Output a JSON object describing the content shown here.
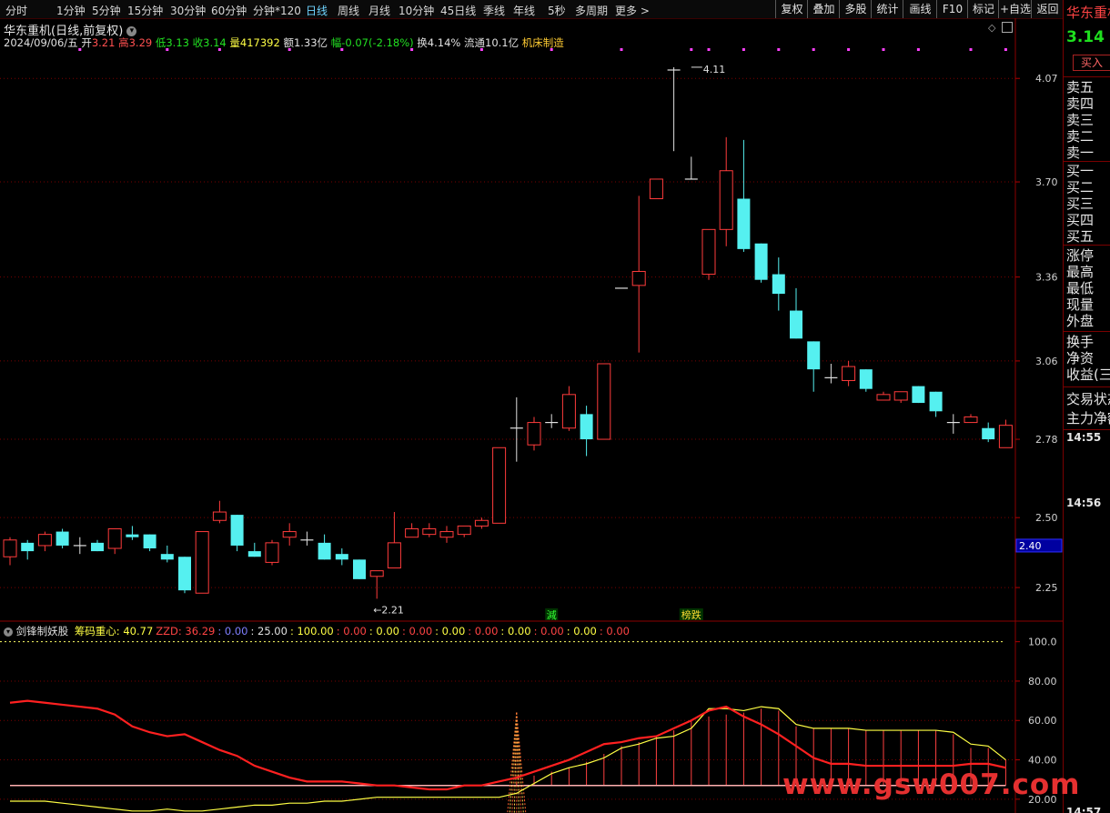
{
  "toolbar": {
    "periods": [
      {
        "label": "分时",
        "active": false
      },
      {
        "label": "1分钟",
        "active": false
      },
      {
        "label": "5分钟",
        "active": false
      },
      {
        "label": "15分钟",
        "active": false
      },
      {
        "label": "30分钟",
        "active": false
      },
      {
        "label": "60分钟",
        "active": false
      },
      {
        "label": "分钟*120",
        "active": false
      },
      {
        "label": "日线",
        "active": true
      },
      {
        "label": "周线",
        "active": false
      },
      {
        "label": "月线",
        "active": false
      },
      {
        "label": "10分钟",
        "active": false
      },
      {
        "label": "45日线",
        "active": false
      },
      {
        "label": "季线",
        "active": false
      },
      {
        "label": "年线",
        "active": false
      },
      {
        "label": "5秒",
        "active": false
      },
      {
        "label": "多周期",
        "active": false
      },
      {
        "label": "更多 >",
        "active": false
      }
    ],
    "right_buttons": [
      "复权",
      "叠加",
      "多股",
      "统计",
      "画线",
      "F10",
      "标记",
      "+自选",
      "返回"
    ]
  },
  "header": {
    "title": "华东重机(日线,前复权)",
    "date": "2024/09/06/五",
    "open_label": "开",
    "open": "3.21",
    "high_label": "高",
    "high": "3.29",
    "low_label": "低",
    "low": "3.13",
    "close_label": "收",
    "close": "3.14",
    "volume_label": "量",
    "volume": "417392",
    "amount_label": "额",
    "amount": "1.33亿",
    "change_label": "幅",
    "change": "-0.07(-2.18%)",
    "turnover_label": "换",
    "turnover": "4.14%",
    "float_label": "流通",
    "float": "10.1亿",
    "industry": "机床制造"
  },
  "indicator": {
    "name": "剑锋制妖股",
    "items": [
      {
        "label": "筹码重心:",
        "value": "40.77",
        "color": "#ffff44"
      },
      {
        "label": "ZZD:",
        "value": "36.29",
        "color": "#ff4444"
      },
      {
        "label": ":",
        "value": "0.00",
        "color": "#7f7fff"
      },
      {
        "label": ":",
        "value": "25.00",
        "color": "#e0e0e0"
      },
      {
        "label": ":",
        "value": "100.00",
        "color": "#ffff44"
      },
      {
        "label": ":",
        "value": "0.00",
        "color": "#ff4444"
      },
      {
        "label": ":",
        "value": "0.00",
        "color": "#ffff44"
      },
      {
        "label": ":",
        "value": "0.00",
        "color": "#ff4444"
      },
      {
        "label": ":",
        "value": "0.00",
        "color": "#ffff44"
      },
      {
        "label": ":",
        "value": "0.00",
        "color": "#ff4444"
      },
      {
        "label": ":",
        "value": "0.00",
        "color": "#ffff44"
      },
      {
        "label": ":",
        "value": "0.00",
        "color": "#ff4444"
      },
      {
        "label": ":",
        "value": "0.00",
        "color": "#ffff44"
      },
      {
        "label": ":",
        "value": "0.00",
        "color": "#ff4444"
      }
    ]
  },
  "chart_data": [
    {
      "type": "candlestick",
      "title": "华东重机(日线,前复权)",
      "y_ticks": [
        "4.07",
        "3.70",
        "3.36",
        "3.06",
        "2.78",
        "2.50",
        "2.25"
      ],
      "ylim": [
        2.13,
        4.23
      ],
      "current_price_tag": "2.40",
      "annotations": [
        {
          "text": "4.11",
          "bar": 39,
          "price": 4.11,
          "kind": "high"
        },
        {
          "text": "2.21",
          "bar": 21,
          "price": 2.21,
          "kind": "low"
        },
        {
          "text": "減",
          "bar": 31,
          "kind": "tag",
          "color": "#33ff33"
        },
        {
          "text": "榜跌",
          "bar": 39,
          "kind": "tag",
          "color": "#ffdd33"
        }
      ],
      "marker_dots": [
        4,
        9,
        12,
        16,
        19,
        23,
        27,
        31,
        35,
        39,
        40,
        42,
        44,
        46,
        48,
        50,
        52,
        55,
        57
      ],
      "candles": [
        [
          2.36,
          2.42,
          2.33,
          2.43
        ],
        [
          2.41,
          2.38,
          2.35,
          2.42
        ],
        [
          2.4,
          2.44,
          2.38,
          2.45
        ],
        [
          2.45,
          2.4,
          2.39,
          2.46
        ],
        [
          2.4,
          2.4,
          2.37,
          2.43
        ],
        [
          2.41,
          2.38,
          2.38,
          2.42
        ],
        [
          2.39,
          2.46,
          2.37,
          2.46
        ],
        [
          2.44,
          2.43,
          2.42,
          2.47
        ],
        [
          2.44,
          2.39,
          2.38,
          2.44
        ],
        [
          2.37,
          2.35,
          2.34,
          2.4
        ],
        [
          2.36,
          2.24,
          2.23,
          2.36
        ],
        [
          2.23,
          2.45,
          2.23,
          2.45
        ],
        [
          2.49,
          2.52,
          2.48,
          2.56
        ],
        [
          2.51,
          2.4,
          2.38,
          2.51
        ],
        [
          2.38,
          2.36,
          2.36,
          2.41
        ],
        [
          2.34,
          2.41,
          2.33,
          2.42
        ],
        [
          2.43,
          2.45,
          2.4,
          2.48
        ],
        [
          2.42,
          2.42,
          2.4,
          2.45
        ],
        [
          2.41,
          2.35,
          2.35,
          2.44
        ],
        [
          2.37,
          2.35,
          2.33,
          2.39
        ],
        [
          2.35,
          2.28,
          2.28,
          2.35
        ],
        [
          2.29,
          2.31,
          2.21,
          2.31
        ],
        [
          2.32,
          2.41,
          2.32,
          2.52
        ],
        [
          2.43,
          2.46,
          2.43,
          2.48
        ],
        [
          2.44,
          2.46,
          2.43,
          2.48
        ],
        [
          2.43,
          2.45,
          2.41,
          2.47
        ],
        [
          2.44,
          2.47,
          2.43,
          2.47
        ],
        [
          2.47,
          2.49,
          2.46,
          2.5
        ],
        [
          2.48,
          2.75,
          2.48,
          2.75
        ],
        [
          2.82,
          2.82,
          2.7,
          2.93
        ],
        [
          2.76,
          2.84,
          2.74,
          2.86
        ],
        [
          2.84,
          2.84,
          2.82,
          2.87
        ],
        [
          2.82,
          2.94,
          2.81,
          2.97
        ],
        [
          2.87,
          2.78,
          2.72,
          2.9
        ],
        [
          2.78,
          3.05,
          2.78,
          3.05
        ],
        [
          3.32,
          3.32,
          3.32,
          3.32
        ],
        [
          3.33,
          3.38,
          3.09,
          3.65
        ],
        [
          3.64,
          3.71,
          3.64,
          3.71
        ],
        [
          4.1,
          4.1,
          3.81,
          4.11
        ],
        [
          3.71,
          3.71,
          3.71,
          3.79
        ],
        [
          3.37,
          3.53,
          3.35,
          3.53
        ],
        [
          3.53,
          3.74,
          3.47,
          3.86
        ],
        [
          3.64,
          3.46,
          3.45,
          3.85
        ],
        [
          3.48,
          3.35,
          3.34,
          3.48
        ],
        [
          3.37,
          3.3,
          3.24,
          3.43
        ],
        [
          3.24,
          3.14,
          3.14,
          3.32
        ],
        [
          3.13,
          3.03,
          2.95,
          3.13
        ],
        [
          3.0,
          3.0,
          2.98,
          3.05
        ],
        [
          2.99,
          3.04,
          2.97,
          3.06
        ],
        [
          3.03,
          2.96,
          2.95,
          3.03
        ],
        [
          2.92,
          2.94,
          2.92,
          2.95
        ],
        [
          2.92,
          2.95,
          2.91,
          2.95
        ],
        [
          2.97,
          2.91,
          2.91,
          2.97
        ],
        [
          2.95,
          2.88,
          2.86,
          2.95
        ],
        [
          2.84,
          2.84,
          2.8,
          2.87
        ],
        [
          2.84,
          2.86,
          2.84,
          2.87
        ],
        [
          2.82,
          2.78,
          2.77,
          2.84
        ],
        [
          2.75,
          2.83,
          2.75,
          2.85
        ]
      ],
      "candle_fields": [
        "open",
        "close",
        "low",
        "high"
      ]
    },
    {
      "type": "line",
      "title": "剑锋制妖股",
      "y_ticks": [
        "100.0",
        "80.00",
        "60.00",
        "40.00",
        "20.00"
      ],
      "ylim": [
        13,
        110
      ],
      "reference_line": 100,
      "series": [
        {
          "name": "筹码重心",
          "color": "#ffff44",
          "values": [
            19,
            19,
            19,
            18,
            17,
            16,
            15,
            14,
            14,
            15,
            14,
            14,
            15,
            16,
            17,
            17,
            18,
            18,
            19,
            19,
            20,
            21,
            21,
            21,
            21,
            21,
            21,
            21,
            21,
            23,
            28,
            33,
            36,
            38,
            41,
            46,
            48,
            51,
            52,
            56,
            66,
            66,
            65,
            67,
            66,
            58,
            56,
            56,
            56,
            55,
            55,
            55,
            55,
            55,
            54,
            48,
            47,
            40
          ]
        },
        {
          "name": "ZZD",
          "color": "#ff2020",
          "values": [
            69,
            70,
            69,
            68,
            67,
            66,
            63,
            57,
            54,
            52,
            53,
            49,
            45,
            42,
            37,
            34,
            31,
            29,
            29,
            29,
            28,
            27,
            27,
            26,
            25,
            25,
            27,
            27,
            29,
            31,
            34,
            37,
            40,
            44,
            48,
            49,
            51,
            52,
            56,
            60,
            65,
            67,
            62,
            58,
            53,
            47,
            41,
            38,
            38,
            37,
            37,
            37,
            37,
            37,
            37,
            38,
            38,
            36
          ]
        }
      ],
      "histogram_top": [
        27,
        27,
        27,
        27,
        27,
        27,
        27,
        27,
        27,
        27,
        27,
        27,
        27,
        27,
        27,
        27,
        27,
        27,
        27,
        27,
        27,
        27,
        27,
        27,
        27,
        27,
        27,
        27,
        27,
        29,
        32,
        34,
        36,
        39,
        43,
        47,
        49,
        52,
        55,
        60,
        62,
        63,
        64,
        66,
        65,
        57,
        56,
        56,
        56,
        55,
        55,
        55,
        55,
        55,
        53,
        46,
        46,
        40
      ],
      "histogram_bottom": 27
    }
  ],
  "sidepanel": {
    "name": "华东重机",
    "price": "3.14",
    "buy_button": "买入",
    "sell_rows": [
      "卖五",
      "卖四",
      "卖三",
      "卖二",
      "卖一"
    ],
    "buy_rows": [
      "买一",
      "买二",
      "买三",
      "买四",
      "买五"
    ],
    "stat_rows": [
      "涨停",
      "最高",
      "最低",
      "现量",
      "外盘"
    ],
    "extra_rows": [
      "换手",
      "净资",
      "收益(三)"
    ],
    "status_rows": [
      "交易状态",
      "主力净额"
    ],
    "times": [
      "14:55",
      "14:56",
      "14:57"
    ]
  },
  "watermark": "www.gsw007.com"
}
